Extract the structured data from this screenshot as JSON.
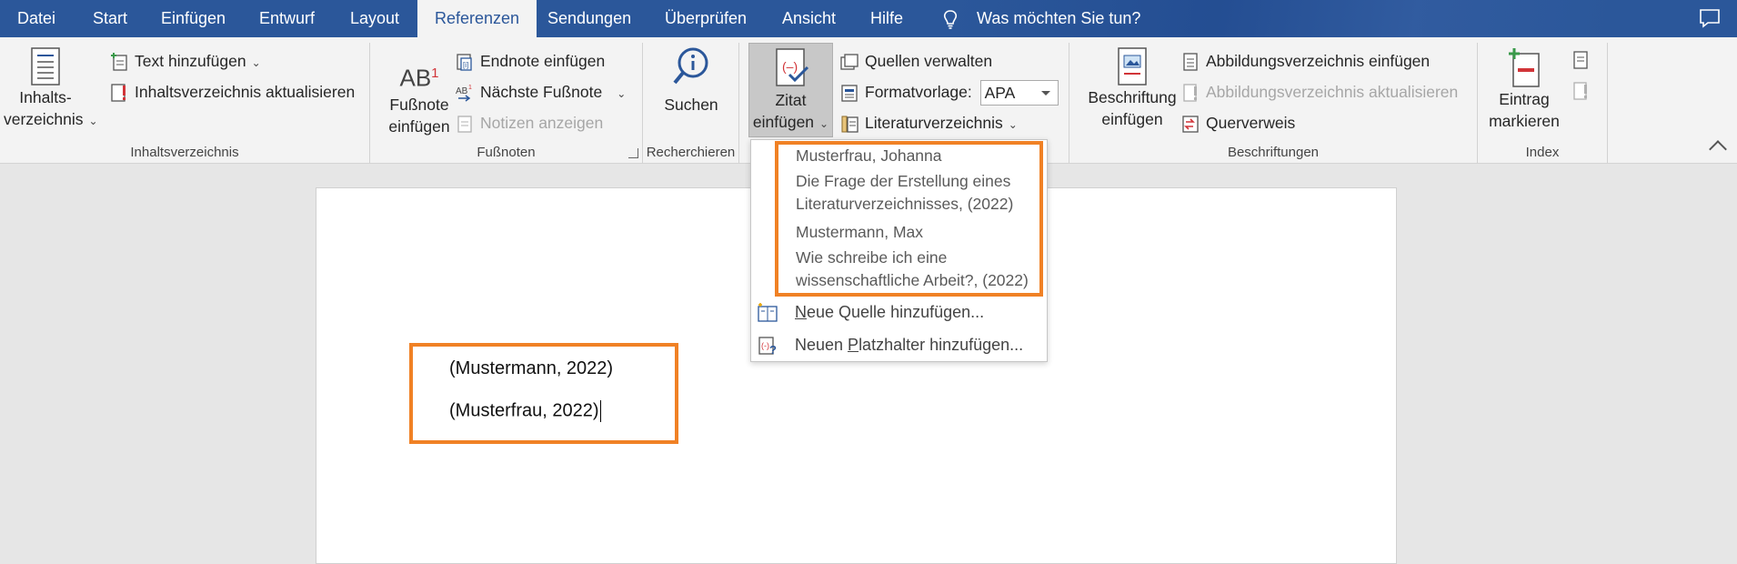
{
  "tabs": [
    "Datei",
    "Start",
    "Einfügen",
    "Entwurf",
    "Layout",
    "Referenzen",
    "Sendungen",
    "Überprüfen",
    "Ansicht",
    "Hilfe"
  ],
  "active_tab": "Referenzen",
  "tell_me": "Was möchten Sie tun?",
  "ribbon": {
    "toc": {
      "big_label_1": "Inhalts-",
      "big_label_2": "verzeichnis",
      "add_text": "Text hinzufügen",
      "update_toc": "Inhaltsverzeichnis aktualisieren",
      "group": "Inhaltsverzeichnis"
    },
    "footnotes": {
      "big_label_1": "Fußnote",
      "big_label_2": "einfügen",
      "big_icon_text": "AB",
      "big_icon_sup": "1",
      "insert_endnote": "Endnote einfügen",
      "next_footnote": "Nächste Fußnote",
      "show_notes": "Notizen anzeigen",
      "group": "Fußnoten"
    },
    "research": {
      "search": "Suchen",
      "group": "Recherchieren"
    },
    "citations": {
      "insert_citation_1": "Zitat",
      "insert_citation_2": "einfügen",
      "manage_sources": "Quellen verwalten",
      "style_label": "Formatvorlage:",
      "style_value": "APA",
      "bibliography": "Literaturverzeichnis"
    },
    "captions": {
      "insert_caption_1": "Beschriftung",
      "insert_caption_2": "einfügen",
      "insert_table_of_figures": "Abbildungsverzeichnis einfügen",
      "update_table": "Abbildungsverzeichnis aktualisieren",
      "cross_reference": "Querverweis",
      "group": "Beschriftungen"
    },
    "index": {
      "mark_entry_1": "Eintrag",
      "mark_entry_2": "markieren",
      "group": "Index"
    }
  },
  "dropdown": {
    "sources": [
      {
        "author": "Musterfrau, Johanna",
        "title_1": "Die Frage der Erstellung eines",
        "title_2": "Literaturverzeichnisses, (2022)"
      },
      {
        "author": "Mustermann, Max",
        "title_1": "Wie schreibe ich eine",
        "title_2": "wissenschaftliche Arbeit?, (2022)"
      }
    ],
    "add_source_u": "N",
    "add_source_rest": "eue Quelle hinzufügen...",
    "add_placeholder_pre": "Neuen ",
    "add_placeholder_u": "P",
    "add_placeholder_rest": "latzhalter hinzufügen..."
  },
  "document": {
    "citations": [
      "(Mustermann, 2022)",
      "(Musterfrau, 2022)"
    ]
  },
  "colors": {
    "tabbar": "#2b579a",
    "highlight": "#f08125",
    "ribbon": "#f3f3f3"
  }
}
